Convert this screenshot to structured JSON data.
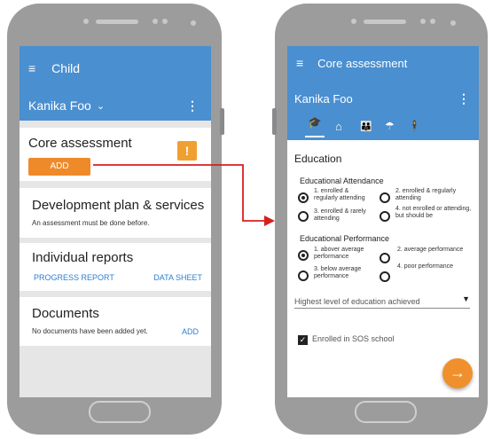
{
  "left": {
    "appbar_title": "Child",
    "child_name": "Kanika Foo",
    "core": {
      "title": "Core assessment",
      "add_label": "ADD",
      "badge_symbol": "!"
    },
    "development": {
      "title": "Development plan & services",
      "note": "An assessment must be done before."
    },
    "reports": {
      "title": "Individual reports",
      "progress_link": "PROGRESS REPORT",
      "datasheet_link": "DATA SHEET"
    },
    "documents": {
      "title": "Documents",
      "note": "No documents have been added yet.",
      "add_link": "ADD"
    }
  },
  "right": {
    "appbar_title": "Core assessment",
    "child_name": "Kanika Foo",
    "tab_icons": [
      "graduation-cap-icon",
      "home-icon",
      "people-icon",
      "umbrella-icon",
      "person-icon"
    ],
    "section_title": "Education",
    "attendance": {
      "title": "Educational Attendance",
      "options": [
        "1. enrolled & regularly attending",
        "2. enrolled & regularly attending",
        "3. enrolled & rarely attending",
        "4. not enrolled or attending, but should be"
      ],
      "selected": 0
    },
    "performance": {
      "title": "Educational Performance",
      "options": [
        "1. abover average performance",
        "2. average performance",
        "3. below average performance",
        "4. poor performance"
      ],
      "selected": 0
    },
    "education_dropdown_placeholder": "Highest level of education achieved",
    "sos_checkbox_label": "Enrolled in SOS school",
    "sos_checked": true,
    "fab_symbol": "→"
  },
  "colors": {
    "appbar": "#4a8fd0",
    "orange": "#ee8a2a",
    "link": "#2f7fd0",
    "arrow": "#d62020",
    "phone": "#9c9c9c"
  }
}
